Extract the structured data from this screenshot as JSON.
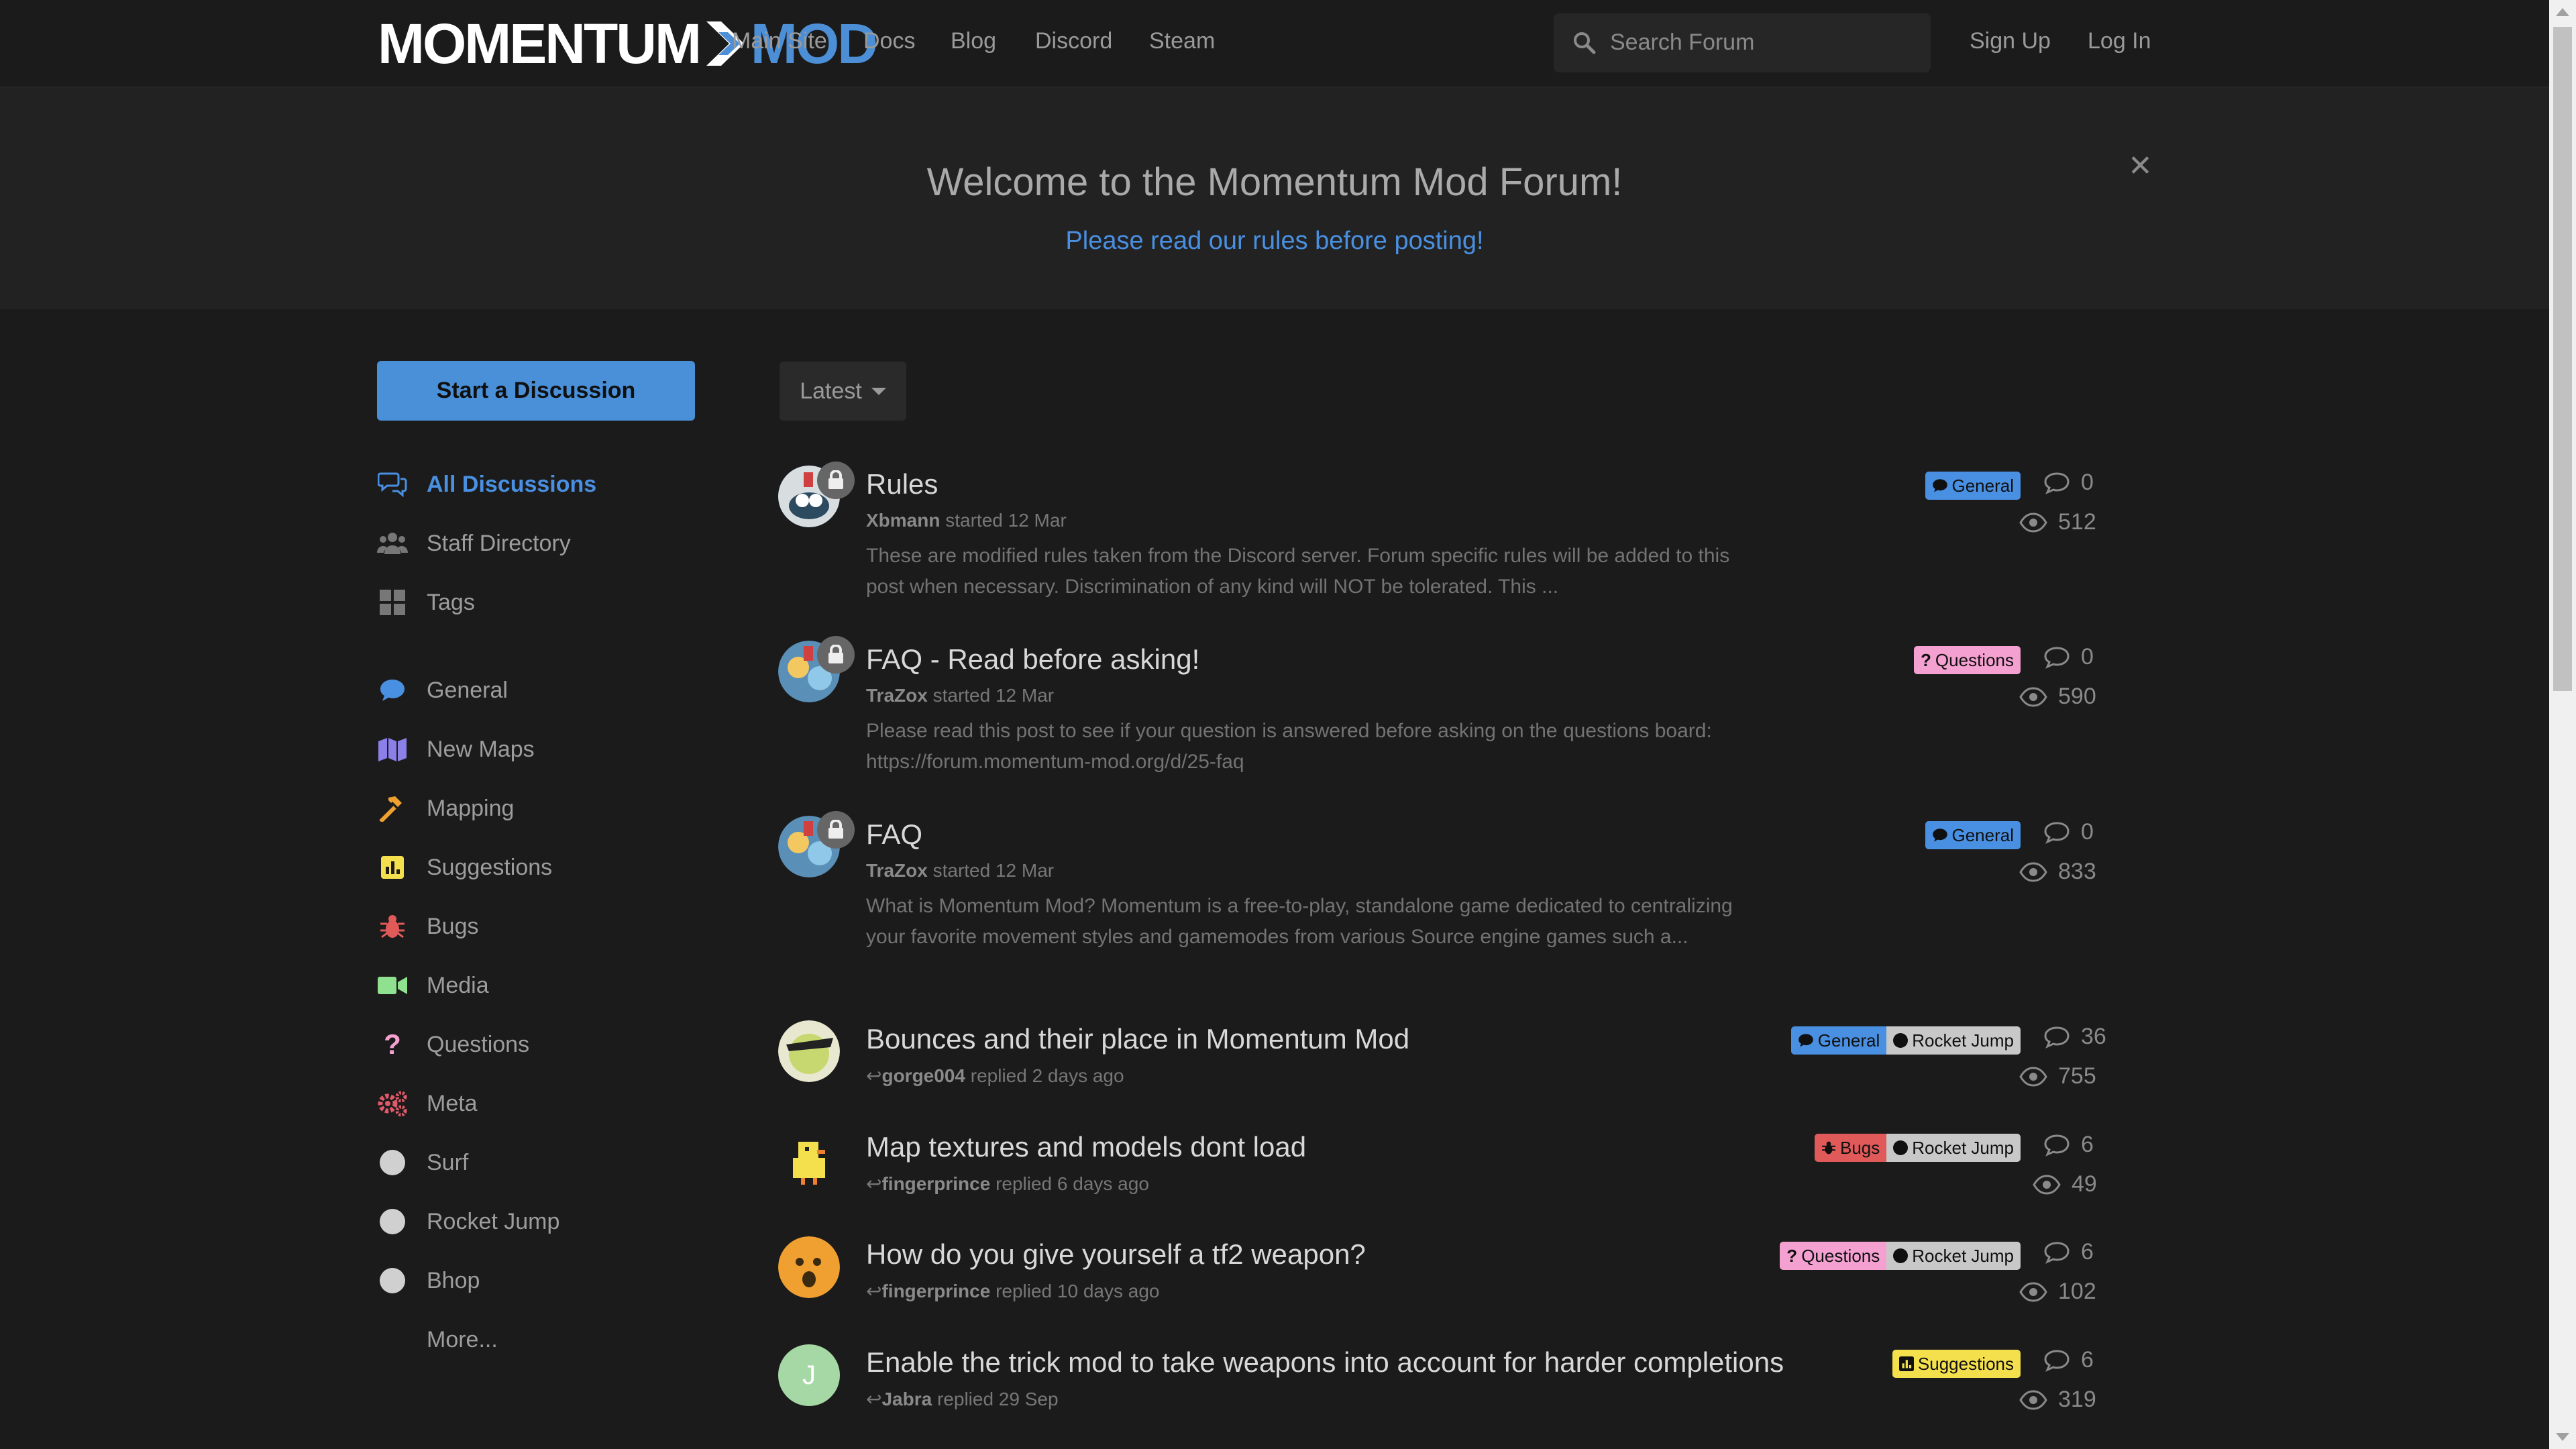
{
  "brand": {
    "part1": "MOMENTUM",
    "part2": "MOD"
  },
  "nav": [
    "Main Site",
    "Docs",
    "Blog",
    "Discord",
    "Steam"
  ],
  "search": {
    "placeholder": "Search Forum"
  },
  "auth": {
    "signup": "Sign Up",
    "login": "Log In"
  },
  "hero": {
    "title": "Welcome to the Momentum Mod Forum!",
    "subtitle": "Please read our rules before posting!"
  },
  "sidebar": {
    "start_button": "Start a Discussion",
    "primary": [
      {
        "label": "All Discussions",
        "icon": "chat-bubbles-icon"
      },
      {
        "label": "Staff Directory",
        "icon": "users-icon"
      },
      {
        "label": "Tags",
        "icon": "grid-icon"
      }
    ],
    "tags": [
      {
        "label": "General",
        "icon": "comment-icon",
        "color": "#4a90e2"
      },
      {
        "label": "New Maps",
        "icon": "map-icon",
        "color": "#8b7fe8"
      },
      {
        "label": "Mapping",
        "icon": "hammer-icon",
        "color": "#f0a030"
      },
      {
        "label": "Suggestions",
        "icon": "chart-icon",
        "color": "#f4e04d"
      },
      {
        "label": "Bugs",
        "icon": "bug-icon",
        "color": "#e05a5a"
      },
      {
        "label": "Media",
        "icon": "video-icon",
        "color": "#8fe08f"
      },
      {
        "label": "Questions",
        "icon": "question-icon",
        "color": "#f4a0d0"
      },
      {
        "label": "Meta",
        "icon": "gears-icon",
        "color": "#e05a6a"
      },
      {
        "label": "Surf",
        "icon": "circle-icon",
        "color": "#d0d0d0"
      },
      {
        "label": "Rocket Jump",
        "icon": "circle-icon",
        "color": "#d0d0d0"
      },
      {
        "label": "Bhop",
        "icon": "circle-icon",
        "color": "#d0d0d0"
      }
    ],
    "more": "More..."
  },
  "sort": {
    "selected": "Latest"
  },
  "discussions": [
    {
      "title": "Rules",
      "author": "Xbmann",
      "action": "started 12 Mar",
      "excerpt": "These are modified rules taken from the Discord server. Forum specific rules will be added to this post when necessary. Discrimination of any kind will NOT be tolerated. This ...",
      "tags": [
        {
          "label": "General",
          "icon": "comment-icon"
        }
      ],
      "replies": "0",
      "views": "512",
      "locked": true
    },
    {
      "title": "FAQ - Read before asking!",
      "author": "TraZox",
      "action": "started 12 Mar",
      "excerpt": "Please read this post to see if your question is answered before asking on the questions board: https://forum.momentum-mod.org/d/25-faq",
      "tags": [
        {
          "label": "Questions",
          "icon": "question-icon"
        }
      ],
      "replies": "0",
      "views": "590",
      "locked": true
    },
    {
      "title": "FAQ",
      "author": "TraZox",
      "action": "started 12 Mar",
      "excerpt": "What is Momentum Mod? Momentum is a free-to-play, standalone game dedicated to centralizing your favorite movement styles and gamemodes from various Source engine games such a...",
      "tags": [
        {
          "label": "General",
          "icon": "comment-icon"
        }
      ],
      "replies": "0",
      "views": "833",
      "locked": true
    },
    {
      "title": "Bounces and their place in Momentum Mod",
      "author": "gorge004",
      "action": "replied 2 days ago",
      "tags": [
        {
          "label": "General",
          "icon": "comment-icon"
        },
        {
          "label": "Rocket Jump",
          "icon": "circle-icon"
        }
      ],
      "replies": "36",
      "views": "755"
    },
    {
      "title": "Map textures and models dont load",
      "author": "fingerprince",
      "action": "replied 6 days ago",
      "tags": [
        {
          "label": "Bugs",
          "icon": "bug-icon"
        },
        {
          "label": "Rocket Jump",
          "icon": "circle-icon"
        }
      ],
      "replies": "6",
      "views": "49"
    },
    {
      "title": "How do you give yourself a tf2 weapon?",
      "author": "fingerprince",
      "action": "replied 10 days ago",
      "tags": [
        {
          "label": "Questions",
          "icon": "question-icon"
        },
        {
          "label": "Rocket Jump",
          "icon": "circle-icon"
        }
      ],
      "replies": "6",
      "views": "102"
    },
    {
      "title": "Enable the trick mod to take weapons into account for harder completions",
      "author": "Jabra",
      "action": "replied 29 Sep",
      "tags": [
        {
          "label": "Suggestions",
          "icon": "chart-icon"
        }
      ],
      "replies": "6",
      "views": "319",
      "avatar_letter": "J"
    }
  ],
  "colors": {
    "accent": "#4a90e2",
    "tag_general": "#4a90e2",
    "tag_questions": "#f4a0d0",
    "tag_bugs": "#e05a5a",
    "tag_rocketjump": "#c8c8c8",
    "tag_suggestions": "#f4e04d"
  }
}
